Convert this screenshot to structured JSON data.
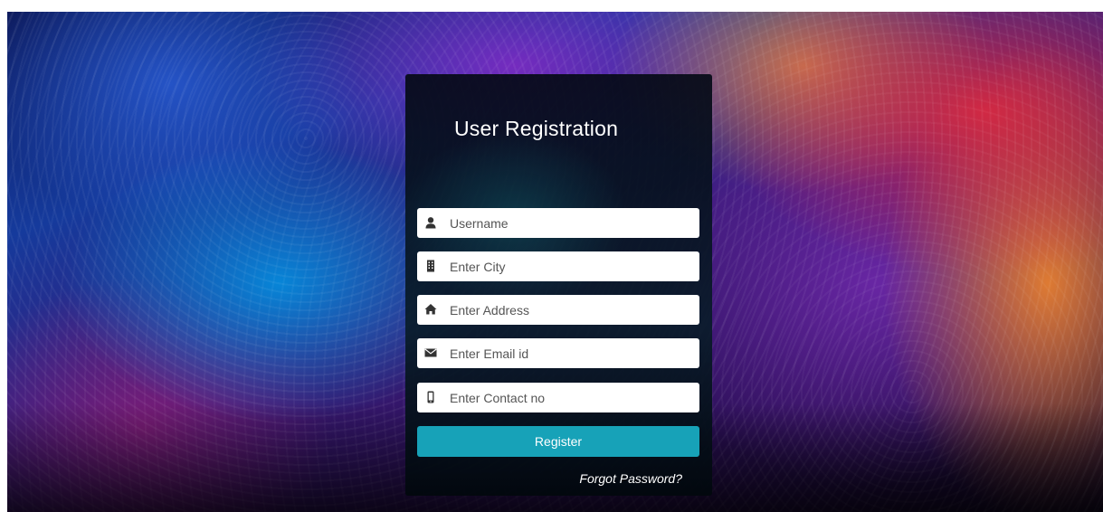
{
  "form": {
    "title": "User Registration",
    "fields": [
      {
        "name": "username",
        "placeholder": "Username",
        "value": "",
        "icon": "user-icon"
      },
      {
        "name": "city",
        "placeholder": "Enter City",
        "value": "",
        "icon": "building-icon"
      },
      {
        "name": "address",
        "placeholder": "Enter Address",
        "value": "",
        "icon": "home-icon"
      },
      {
        "name": "email",
        "placeholder": "Enter Email id",
        "value": "",
        "icon": "envelope-icon"
      },
      {
        "name": "contact",
        "placeholder": "Enter Contact no",
        "value": "",
        "icon": "mobile-phone-icon"
      }
    ],
    "register_label": "Register",
    "forgot_label": "Forgot Password?"
  },
  "colors": {
    "button": "#17a2b8",
    "card": "#07121e",
    "input_bg": "#ffffff",
    "icon": "#333333"
  }
}
